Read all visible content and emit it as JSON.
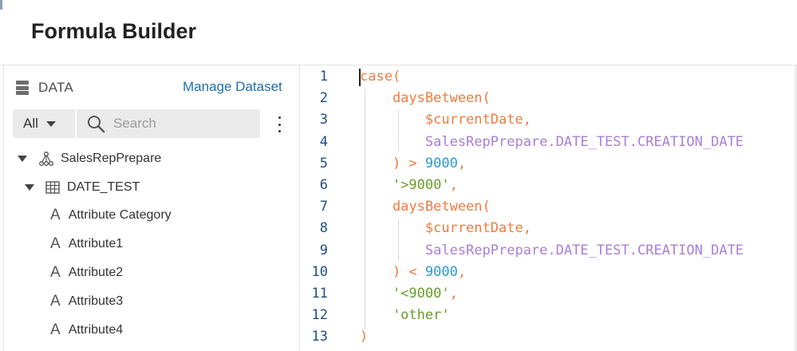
{
  "header": {
    "title": "Formula Builder"
  },
  "sidebar": {
    "data_label": "DATA",
    "manage_label": "Manage Dataset",
    "filter": {
      "selected": "All",
      "search_placeholder": "Search"
    },
    "tree": {
      "root": "SalesRepPrepare",
      "table": "DATE_TEST",
      "attributes": [
        "Attribute Category",
        "Attribute1",
        "Attribute2",
        "Attribute3",
        "Attribute4"
      ]
    }
  },
  "editor": {
    "colors": {
      "keyword": "#f07b3f",
      "identifier": "#a87fd6",
      "number": "#2a9ad4",
      "string": "#6a9b2c",
      "line_number": "#1d4f80"
    },
    "lines": [
      {
        "n": "1",
        "tokens": [
          {
            "t": "case(",
            "c": "keyword"
          }
        ]
      },
      {
        "n": "2",
        "tokens": [
          {
            "t": "    daysBetween(",
            "c": "keyword"
          }
        ]
      },
      {
        "n": "3",
        "tokens": [
          {
            "t": "        $currentDate",
            "c": "keyword"
          },
          {
            "t": ",",
            "c": "keyword"
          }
        ]
      },
      {
        "n": "4",
        "tokens": [
          {
            "t": "        SalesRepPrepare.DATE_TEST.CREATION_DATE",
            "c": "identifier"
          }
        ]
      },
      {
        "n": "5",
        "tokens": [
          {
            "t": "    ) > ",
            "c": "keyword"
          },
          {
            "t": "9000",
            "c": "number"
          },
          {
            "t": ",",
            "c": "keyword"
          }
        ]
      },
      {
        "n": "6",
        "tokens": [
          {
            "t": "    '>9000'",
            "c": "string"
          },
          {
            "t": ",",
            "c": "keyword"
          }
        ]
      },
      {
        "n": "7",
        "tokens": [
          {
            "t": "    daysBetween(",
            "c": "keyword"
          }
        ]
      },
      {
        "n": "8",
        "tokens": [
          {
            "t": "        $currentDate",
            "c": "keyword"
          },
          {
            "t": ",",
            "c": "keyword"
          }
        ]
      },
      {
        "n": "9",
        "tokens": [
          {
            "t": "        SalesRepPrepare.DATE_TEST.CREATION_DATE",
            "c": "identifier"
          }
        ]
      },
      {
        "n": "10",
        "tokens": [
          {
            "t": "    ) < ",
            "c": "keyword"
          },
          {
            "t": "9000",
            "c": "number"
          },
          {
            "t": ",",
            "c": "keyword"
          }
        ]
      },
      {
        "n": "11",
        "tokens": [
          {
            "t": "    '<9000'",
            "c": "string"
          },
          {
            "t": ",",
            "c": "keyword"
          }
        ]
      },
      {
        "n": "12",
        "tokens": [
          {
            "t": "    'other'",
            "c": "string"
          }
        ]
      },
      {
        "n": "13",
        "tokens": [
          {
            "t": ")",
            "c": "keyword"
          }
        ]
      }
    ]
  }
}
